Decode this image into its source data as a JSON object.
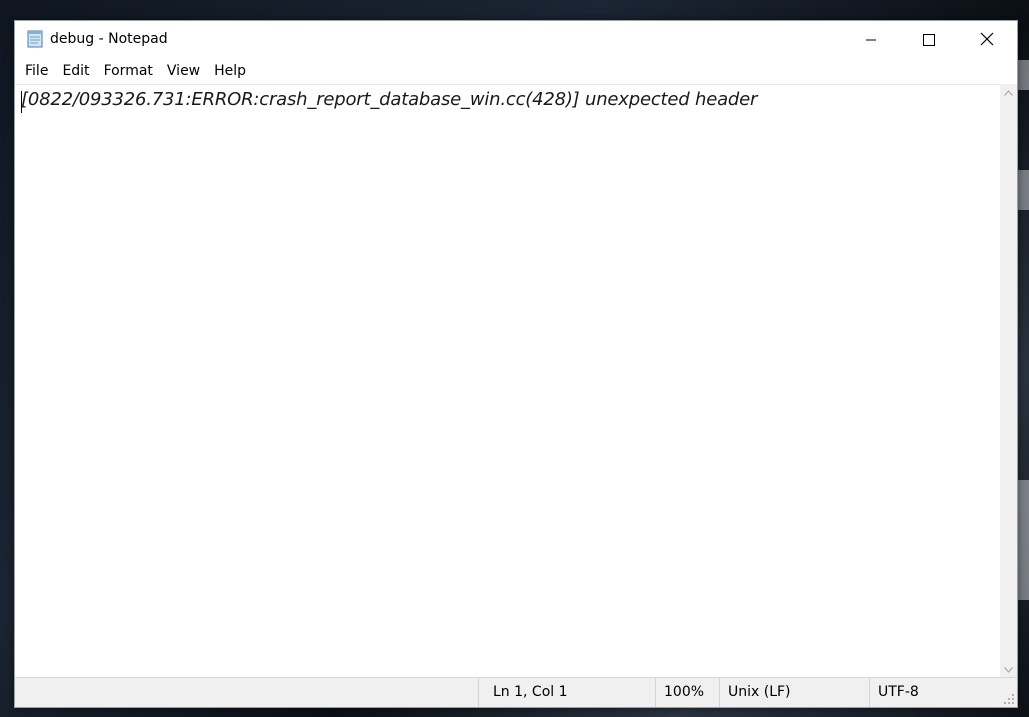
{
  "window": {
    "title": "debug - Notepad",
    "icon": "notepad-icon"
  },
  "caption_buttons": {
    "minimize": "minimize-icon",
    "maximize": "maximize-icon",
    "close": "close-icon"
  },
  "menu": {
    "items": [
      {
        "label": "File"
      },
      {
        "label": "Edit"
      },
      {
        "label": "Format"
      },
      {
        "label": "View"
      },
      {
        "label": "Help"
      }
    ]
  },
  "editor": {
    "content": "[0822/093326.731:ERROR:crash_report_database_win.cc(428)] unexpected header"
  },
  "status": {
    "position": "Ln 1, Col 1",
    "zoom": "100%",
    "line_ending": "Unix (LF)",
    "encoding": "UTF-8"
  }
}
